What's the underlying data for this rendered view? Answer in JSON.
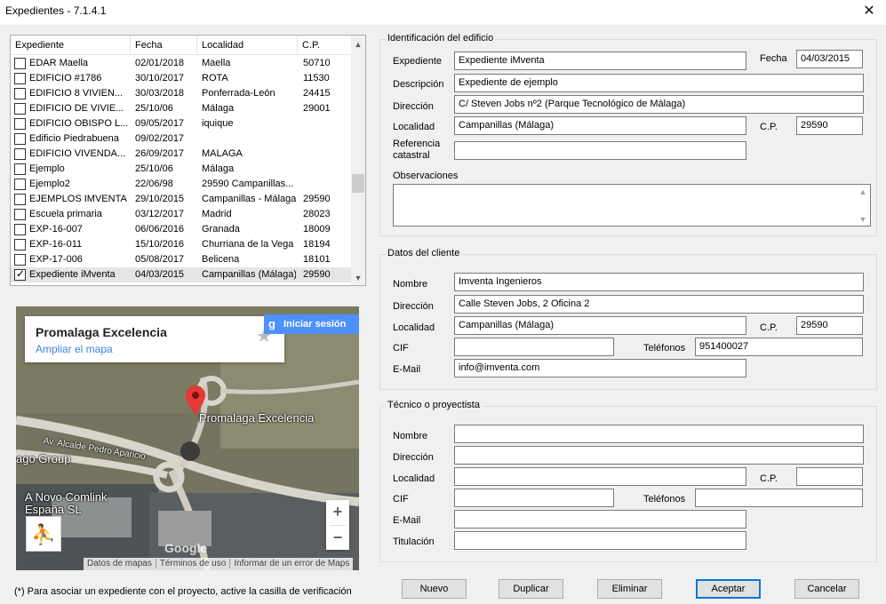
{
  "window": {
    "title": "Expedientes - 7.1.4.1",
    "close_glyph": "✕"
  },
  "list": {
    "columns": [
      "Expediente",
      "Fecha",
      "Localidad",
      "C.P."
    ],
    "rows": [
      {
        "checked": false,
        "expediente": "EDAR Maella",
        "fecha": "02/01/2018",
        "localidad": "Maella",
        "cp": "50710"
      },
      {
        "checked": false,
        "expediente": "EDIFICIO #1786",
        "fecha": "30/10/2017",
        "localidad": "ROTA",
        "cp": "11530"
      },
      {
        "checked": false,
        "expediente": "EDIFICIO 8 VIVIEN...",
        "fecha": "30/03/2018",
        "localidad": "Ponferrada-León",
        "cp": "24415"
      },
      {
        "checked": false,
        "expediente": "EDIFICIO DE VIVIE...",
        "fecha": "25/10/06",
        "localidad": "Málaga",
        "cp": "29001"
      },
      {
        "checked": false,
        "expediente": "EDIFICIO OBISPO L...",
        "fecha": "09/05/2017",
        "localidad": "iquique",
        "cp": ""
      },
      {
        "checked": false,
        "expediente": "Edificio Piedrabuena",
        "fecha": "09/02/2017",
        "localidad": "",
        "cp": ""
      },
      {
        "checked": false,
        "expediente": "EDIFICIO VIVENDA...",
        "fecha": "26/09/2017",
        "localidad": "MALAGA",
        "cp": ""
      },
      {
        "checked": false,
        "expediente": "Ejemplo",
        "fecha": "25/10/06",
        "localidad": "Málaga",
        "cp": ""
      },
      {
        "checked": false,
        "expediente": "Ejemplo2",
        "fecha": "22/06/98",
        "localidad": "29590 Campanillas...",
        "cp": ""
      },
      {
        "checked": false,
        "expediente": "EJEMPLOS IMVENTA",
        "fecha": "29/10/2015",
        "localidad": "Campanillas - Málaga",
        "cp": "29590"
      },
      {
        "checked": false,
        "expediente": "Escuela primaria",
        "fecha": "03/12/2017",
        "localidad": "  Madrid",
        "cp": "28023"
      },
      {
        "checked": false,
        "expediente": "EXP-16-007",
        "fecha": "06/06/2016",
        "localidad": "Granada",
        "cp": "18009"
      },
      {
        "checked": false,
        "expediente": "EXP-16-011",
        "fecha": "15/10/2016",
        "localidad": "Churriana de la Vega",
        "cp": "18194"
      },
      {
        "checked": false,
        "expediente": "EXP-17-006",
        "fecha": "05/08/2017",
        "localidad": "Belicena",
        "cp": "18101"
      },
      {
        "checked": true,
        "expediente": "Expediente iMventa",
        "fecha": "04/03/2015",
        "localidad": "Campanillas (Málaga)",
        "cp": "29590"
      }
    ]
  },
  "map": {
    "place_name": "Promalaga Excelencia",
    "enlarge_link": "Ampliar el mapa",
    "signin": "Iniciar sesión",
    "pin_label": "Promalaga Excelencia",
    "street_label": "Av. Alcalde Pedro Aparicio",
    "label_group": "ago Group",
    "label_comlink_1": "A Novo Comlink",
    "label_comlink_2": "España SL",
    "google": "Google",
    "zoom_in": "+",
    "zoom_out": "−",
    "footer": [
      "Datos de mapas",
      "Términos de uso",
      "Informar de un error de Maps"
    ]
  },
  "footnote": "(*) Para asociar un expediente con el proyecto, active la casilla de verificación",
  "building": {
    "legend": "Identificación del edificio",
    "labels": {
      "expediente": "Expediente",
      "fecha": "Fecha",
      "descripcion": "Descripción",
      "direccion": "Dirección",
      "localidad": "Localidad",
      "cp": "C.P.",
      "referencia_1": "Referencia",
      "referencia_2": "catastral",
      "observaciones": "Observaciones"
    },
    "values": {
      "expediente": "Expediente iMventa",
      "fecha": "04/03/2015",
      "descripcion": "Expediente de ejemplo",
      "direccion": "C/ Steven Jobs nº2 (Parque Tecnológico de Málaga)",
      "localidad": "Campanillas (Málaga)",
      "cp": "29590",
      "referencia": "",
      "observaciones": ""
    }
  },
  "client": {
    "legend": "Datos del cliente",
    "labels": {
      "nombre": "Nombre",
      "direccion": "Dirección",
      "localidad": "Localidad",
      "cp": "C.P.",
      "cif": "CIF",
      "telefonos": "Teléfonos",
      "email": "E-Mail"
    },
    "values": {
      "nombre": "Imventa Ingenieros",
      "direccion": "Calle Steven Jobs, 2 Oficina 2",
      "localidad": "Campanillas (Málaga)",
      "cp": "29590",
      "cif": "",
      "telefonos": "951400027",
      "email": "info@imventa.com"
    }
  },
  "tecnico": {
    "legend": "Técnico o proyectista",
    "labels": {
      "nombre": "Nombre",
      "direccion": "Dirección",
      "localidad": "Localidad",
      "cp": "C.P.",
      "cif": "CIF",
      "telefonos": "Teléfonos",
      "email": "E-Mail",
      "titulacion": "Titulación"
    },
    "values": {
      "nombre": "",
      "direccion": "",
      "localidad": "",
      "cp": "",
      "cif": "",
      "telefonos": "",
      "email": "",
      "titulacion": ""
    }
  },
  "buttons": {
    "nuevo": "Nuevo",
    "duplicar": "Duplicar",
    "eliminar": "Eliminar",
    "aceptar": "Aceptar",
    "cancelar": "Cancelar"
  }
}
